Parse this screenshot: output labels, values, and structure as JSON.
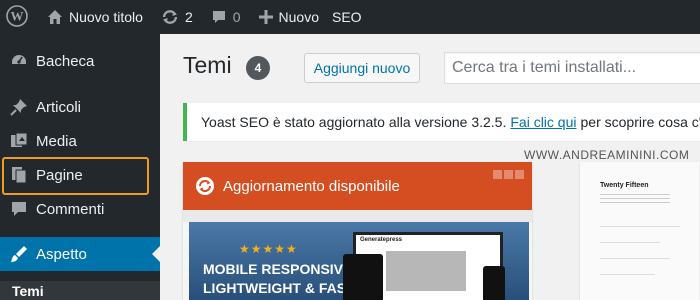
{
  "admin_bar": {
    "site_name": "Nuovo titolo",
    "updates_count": "2",
    "comments_count": "0",
    "new_label": "Nuovo",
    "seo_label": "SEO"
  },
  "sidebar": {
    "items": [
      {
        "label": "Bacheca",
        "icon": "dashboard-icon"
      },
      {
        "label": "Articoli",
        "icon": "pin-icon"
      },
      {
        "label": "Media",
        "icon": "media-icon"
      },
      {
        "label": "Pagine",
        "icon": "pages-icon"
      },
      {
        "label": "Commenti",
        "icon": "comment-icon"
      },
      {
        "label": "Aspetto",
        "icon": "appearance-icon"
      }
    ],
    "submenu_current": "Temi"
  },
  "main": {
    "page_title": "Temi",
    "theme_count": "4",
    "add_new_label": "Aggiungi nuovo",
    "search_placeholder": "Cerca tra i temi installati...",
    "notice": {
      "before": "Yoast SEO è stato aggiornato alla versione 3.2.5.",
      "link": "Fai clic qui",
      "after": "per scoprire cosa c'è di nuovo!"
    },
    "watermark": "WWW.ANDREAMININI.COM",
    "theme1": {
      "update_label": "Aggiornamento disponibile",
      "stars": "★★★★★",
      "promo_line1": "MOBILE  RESPONSIVE",
      "promo_line2": "LIGHTWEIGHT & FAST",
      "device_heading": "Generatepress"
    },
    "theme2": {
      "name": "Twenty Fifteen"
    }
  },
  "colors": {
    "admin_bg": "#23282d",
    "active_blue": "#0073aa",
    "update_orange": "#d54e21",
    "notice_green": "#46b450",
    "highlight_orange": "#f29a1a"
  }
}
